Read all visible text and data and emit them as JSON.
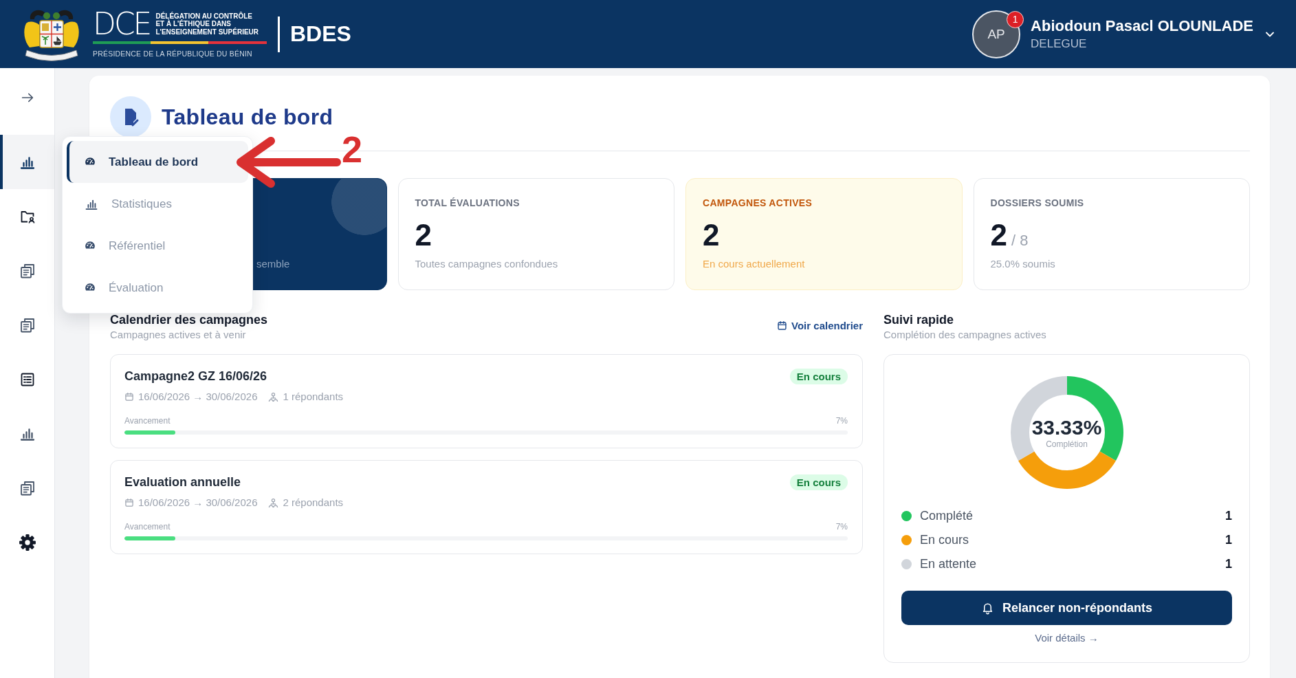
{
  "header": {
    "logo": {
      "acronym": "DCE",
      "tagline": [
        "DÉLÉGATION AU CONTRÔLE",
        "ET À L'ÉTHIQUE DANS",
        "L'ENSEIGNEMENT SUPÉRIEUR"
      ],
      "subtitle": "PRÉSIDENCE DE LA RÉPUBLIQUE DU BÉNIN"
    },
    "app_name": "BDES",
    "user": {
      "initials": "AP",
      "notifications": "1",
      "name": "Abiodoun Pasacl OLOUNLADE",
      "role": "DELEGUE"
    }
  },
  "sidebar": {
    "items": [
      {
        "selected": true
      },
      {
        "selected": false
      },
      {
        "selected": false
      },
      {
        "selected": false
      },
      {
        "selected": false
      },
      {
        "selected": false
      },
      {
        "selected": false
      },
      {
        "selected": false
      }
    ]
  },
  "submenu": {
    "items": [
      {
        "label": "Tableau de bord",
        "selected": true
      },
      {
        "label": "Statistiques",
        "selected": false
      },
      {
        "label": "Référentiel",
        "selected": false
      },
      {
        "label": "Évaluation",
        "selected": false
      }
    ]
  },
  "annotation": {
    "label": "2"
  },
  "page": {
    "title": "Tableau de bord"
  },
  "stat_cards": [
    {
      "kind": "featured",
      "caption": "semble"
    },
    {
      "kind": "plain",
      "label": "TOTAL ÉVALUATIONS",
      "value": "2",
      "caption": "Toutes campagnes confondues"
    },
    {
      "kind": "highlight",
      "label": "CAMPAGNES ACTIVES",
      "value": "2",
      "caption": "En cours actuellement"
    },
    {
      "kind": "plain",
      "label": "DOSSIERS SOUMIS",
      "value": "2",
      "total": "/ 8",
      "caption": "25.0% soumis"
    }
  ],
  "campaigns": {
    "title": "Calendrier des campagnes",
    "subtitle": "Campagnes actives et à venir",
    "link": "Voir calendrier",
    "items": [
      {
        "name": "Campagne2 GZ 16/06/26",
        "status": "En cours",
        "dates": "16/06/2026 → 30/06/2026",
        "respondents": "1 répondants",
        "progress_label": "Avancement",
        "progress_value": "7%",
        "level": 0.07
      },
      {
        "name": "Evaluation annuelle",
        "status": "En cours",
        "dates": "16/06/2026 → 30/06/2026",
        "respondents": "2 répondants",
        "progress_label": "Avancement",
        "progress_value": "7%",
        "level": 0.07
      }
    ]
  },
  "suivi": {
    "title": "Suivi rapide",
    "subtitle": "Complétion des campagnes actives",
    "center_value": "33.33%",
    "center_label": "Complétion",
    "chart_data": {
      "type": "donut",
      "categories": [
        "Complété",
        "En cours",
        "En attente"
      ],
      "values": [
        33.33,
        33.33,
        33.34
      ],
      "legend": "bottom"
    },
    "legend_items": [
      {
        "color": "#22c55e",
        "value": "1"
      },
      {
        "color": "#f59e0b",
        "value": "1"
      },
      {
        "color": "#d1d5db",
        "value": "1"
      }
    ],
    "button": "Relancer non-répondants",
    "link": "Voir détails →"
  }
}
